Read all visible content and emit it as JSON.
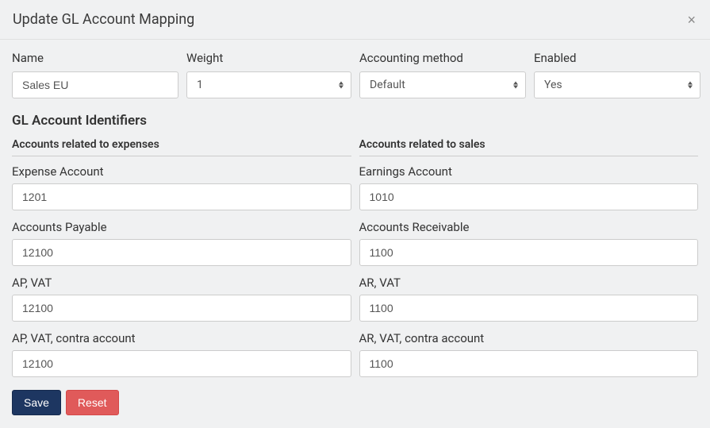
{
  "header": {
    "title": "Update GL Account Mapping",
    "close": "×"
  },
  "top": {
    "name_label": "Name",
    "name_value": "Sales EU",
    "weight_label": "Weight",
    "weight_value": "1",
    "accounting_label": "Accounting method",
    "accounting_value": "Default",
    "enabled_label": "Enabled",
    "enabled_value": "Yes"
  },
  "section_title": "GL Account Identifiers",
  "expenses": {
    "header": "Accounts related to expenses",
    "expense_account_label": "Expense Account",
    "expense_account_value": "1201",
    "ap_label": "Accounts Payable",
    "ap_value": "12100",
    "ap_vat_label": "AP, VAT",
    "ap_vat_value": "12100",
    "ap_vat_contra_label": "AP, VAT, contra account",
    "ap_vat_contra_value": "12100"
  },
  "sales": {
    "header": "Accounts related to sales",
    "earnings_label": "Earnings Account",
    "earnings_value": "1010",
    "ar_label": "Accounts Receivable",
    "ar_value": "1100",
    "ar_vat_label": "AR, VAT",
    "ar_vat_value": "1100",
    "ar_vat_contra_label": "AR, VAT, contra account",
    "ar_vat_contra_value": "1100"
  },
  "buttons": {
    "save": "Save",
    "reset": "Reset"
  }
}
